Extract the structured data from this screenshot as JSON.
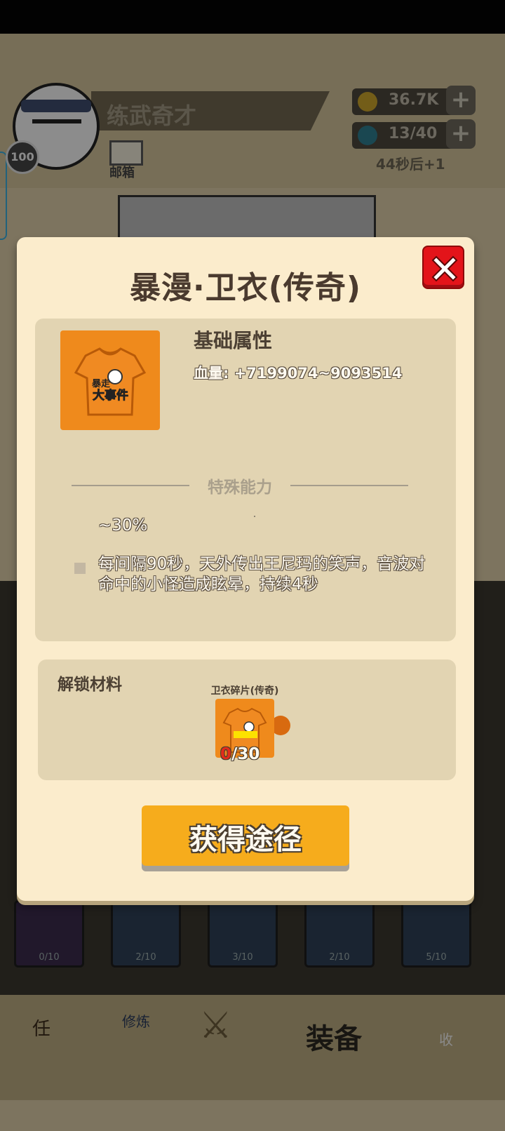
{
  "background": {
    "player_name": "练武奇才",
    "player_level": "100",
    "mail_label": "邮箱",
    "gold_value": "36.7K",
    "stamina_value": "13/40",
    "stamina_timer": "44秒后+1",
    "plus_label": "+",
    "slots": [
      "0/10",
      "2/10",
      "3/10",
      "2/10",
      "5/10"
    ],
    "nav": {
      "task_glyph": "任",
      "cultivate_glyph": "修炼",
      "equip_label": "装备",
      "collect_glyph": "收"
    }
  },
  "modal": {
    "title": "暴漫·卫衣(传奇)",
    "base_attr_title": "基础属性",
    "hp_line": "血量: +7199074~9093514",
    "special_title": "特殊能力",
    "special_percent": "~30%",
    "special_desc": "每间隔90秒，天外传出王尼玛的笑声，音波对命中的小怪造成眩晕，持续4秒",
    "unlock_title": "解锁材料",
    "fragment_label": "卫衣碎片(传奇)",
    "fragment_owned": "0",
    "fragment_required": "/30",
    "get_button_label": "获得途径",
    "shirt_logo_top": "暴走",
    "shirt_logo_bottom": "大事件"
  },
  "colors": {
    "modal_bg": "#fbeccc",
    "panel_bg": "#e2d4b2",
    "button_orange": "#f6ac1c",
    "close_red": "#e3141a",
    "item_orange": "#ef8a1c"
  },
  "icons": {
    "close": "close-x-icon",
    "shirt": "orange-tshirt-icon",
    "gold": "gold-coin-icon",
    "stamina": "stamina-drop-icon",
    "mail": "mail-envelope-icon"
  }
}
